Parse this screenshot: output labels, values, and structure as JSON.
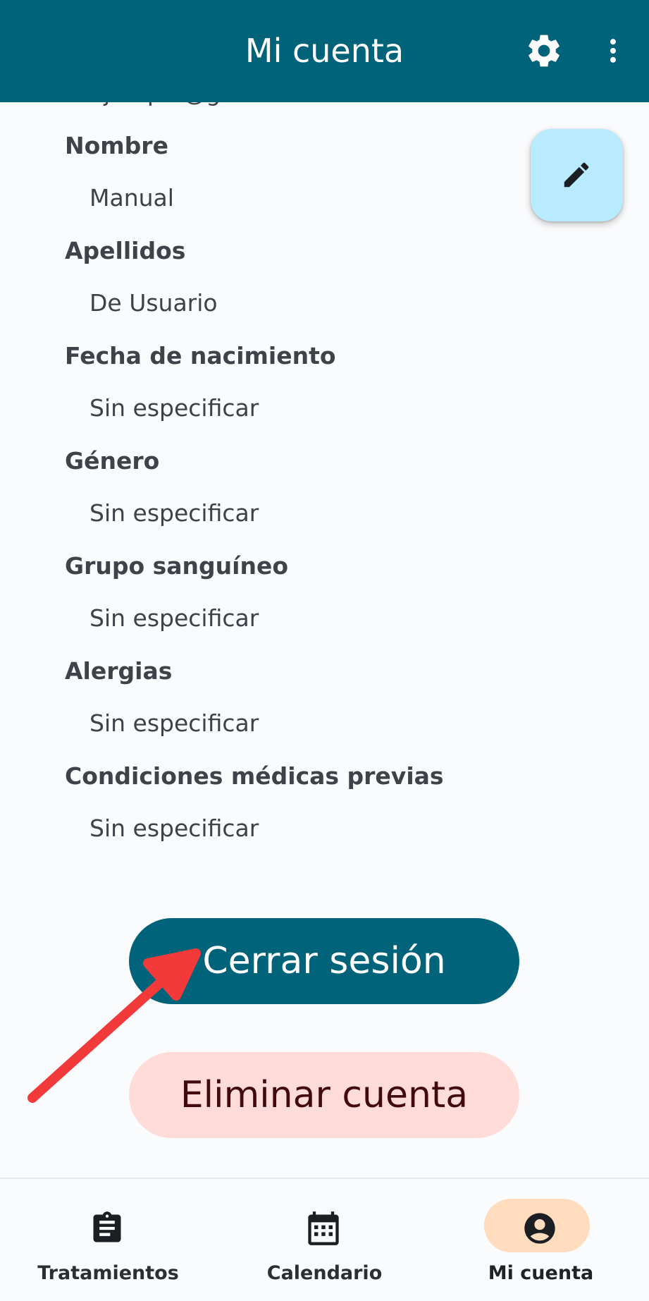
{
  "app_bar": {
    "title": "Mi cuenta",
    "background": "#00637a",
    "actions": [
      "gear-icon",
      "more-vertical-icon"
    ]
  },
  "profile": {
    "email_partial": "ejemplo@gmail.com",
    "fields": [
      {
        "label": "Nombre",
        "value": "Manual"
      },
      {
        "label": "Apellidos",
        "value": "De Usuario"
      },
      {
        "label": "Fecha de nacimiento",
        "value": "Sin especificar"
      },
      {
        "label": "Género",
        "value": "Sin especificar"
      },
      {
        "label": "Grupo sanguíneo",
        "value": "Sin especificar"
      },
      {
        "label": "Alergias",
        "value": "Sin especificar"
      },
      {
        "label": "Condiciones médicas previas",
        "value": "Sin especificar"
      }
    ]
  },
  "fab": {
    "icon": "edit-pencil-icon",
    "color": "#b8ebff"
  },
  "actions": {
    "logout_label": "Cerrar sesión",
    "delete_label": "Eliminar cuenta",
    "logout_color": "#00637a",
    "delete_color": "#ffdcd8"
  },
  "annotation": {
    "arrow_color": "#f23a3a"
  },
  "bottom_nav": {
    "items": [
      {
        "label": "Tratamientos",
        "icon": "clipboard-icon",
        "active": false
      },
      {
        "label": "Calendario",
        "icon": "calendar-icon",
        "active": false
      },
      {
        "label": "Mi cuenta",
        "icon": "account-circle-icon",
        "active": true
      }
    ],
    "active_color": "#ffdcbe"
  }
}
